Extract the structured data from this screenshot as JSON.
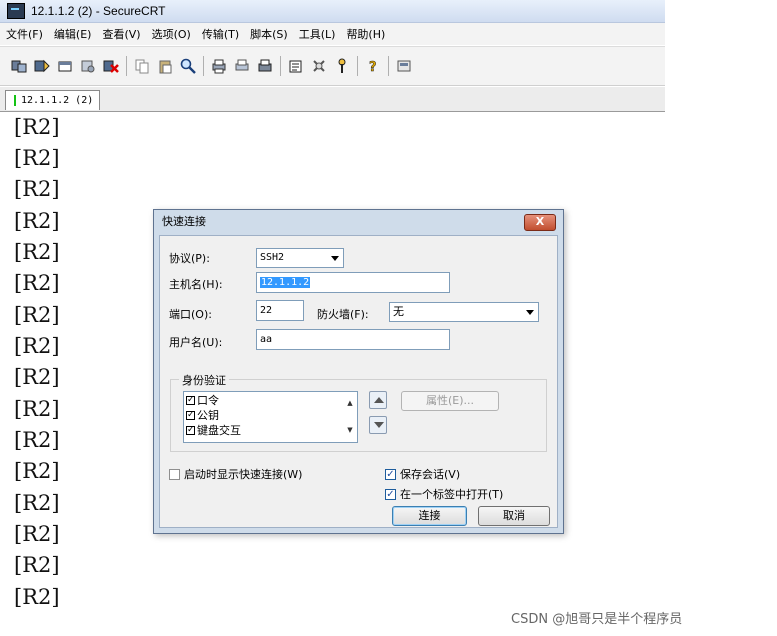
{
  "window": {
    "title": "12.1.1.2 (2) - SecureCRT"
  },
  "menu": [
    "文件(F)",
    "编辑(E)",
    "查看(V)",
    "选项(O)",
    "传输(T)",
    "脚本(S)",
    "工具(L)",
    "帮助(H)"
  ],
  "toolbar": {
    "icons": [
      "connect-icon",
      "quick-connect-icon",
      "connect-tab-icon",
      "reconnect-icon",
      "disconnect-icon",
      "copy-icon",
      "paste-icon",
      "find-icon",
      "print-icon",
      "print-selection-icon",
      "print-setup-icon",
      "session-options-icon",
      "global-options-icon",
      "key-icon",
      "help-icon",
      "about-icon"
    ]
  },
  "tab": {
    "label": "12.1.1.2 (2)",
    "indicator_color": "#15c315"
  },
  "terminal": {
    "lines": [
      "[R2]",
      "[R2]",
      "[R2]",
      "[R2]",
      "[R2]",
      "[R2]",
      "[R2]",
      "[R2]",
      "[R2]",
      "[R2]",
      "[R2]",
      "[R2]",
      "[R2]",
      "[R2]",
      "[R2]",
      "[R2]"
    ]
  },
  "dialog": {
    "title": "快速连接",
    "close_label": "X",
    "protocol_label": "协议(P):",
    "protocol_value": "SSH2",
    "hostname_label": "主机名(H):",
    "hostname_value": "12.1.1.2",
    "port_label": "端口(O):",
    "port_value": "22",
    "firewall_label": "防火墙(F):",
    "firewall_value": "无",
    "username_label": "用户名(U):",
    "username_value": "aa",
    "auth_group_label": "身份验证",
    "auth_methods": [
      {
        "label": "口令",
        "checked": true
      },
      {
        "label": "公钥",
        "checked": true
      },
      {
        "label": "键盘交互",
        "checked": true
      }
    ],
    "properties_button": "属性(E)...",
    "show_on_startup_label": "启动时显示快速连接(W)",
    "show_on_startup_checked": false,
    "save_session_label": "保存会话(V)",
    "save_session_checked": true,
    "open_in_tab_label": "在一个标签中打开(T)",
    "open_in_tab_checked": true,
    "connect_button": "连接",
    "cancel_button": "取消"
  },
  "watermark": "CSDN @旭哥只是半个程序员"
}
